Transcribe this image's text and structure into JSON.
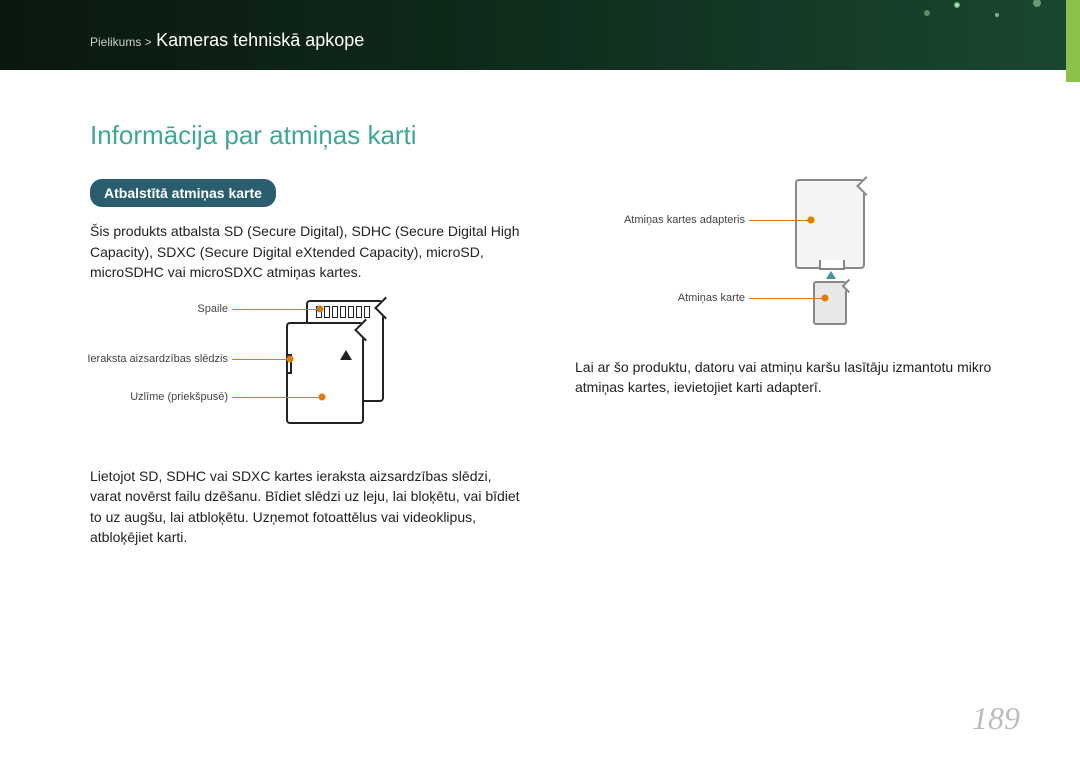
{
  "breadcrumb": {
    "prefix": "Pielikums >",
    "title": "Kameras tehniskā apkope"
  },
  "section_title": "Informācija par atmiņas karti",
  "pill": "Atbalstītā atmiņas karte",
  "left": {
    "p1": "Šis produkts atbalsta SD (Secure Digital), SDHC (Secure Digital High Capacity), SDXC (Secure Digital eXtended Capacity), microSD, microSDHC vai microSDXC atmiņas kartes.",
    "d1": {
      "terminal": "Spaile",
      "wp": "Ieraksta aizsardzības slēdzis",
      "label": "Uzlīme (priekšpusē)"
    },
    "p2": "Lietojot SD, SDHC vai SDXC kartes ieraksta aizsardzības slēdzi, varat novērst failu dzēšanu. Bīdiet slēdzi uz leju, lai bloķētu, vai bīdiet to uz augšu, lai atbloķētu. Uzņemot fotoattēlus vai videoklipus, atbloķējiet karti."
  },
  "right": {
    "d2": {
      "adapter": "Atmiņas kartes adapteris",
      "card": "Atmiņas karte"
    },
    "p1": "Lai ar šo produktu, datoru vai atmiņu karšu lasītāju izmantotu mikro atmiņas kartes, ievietojiet karti adapterī."
  },
  "page_number": "189"
}
